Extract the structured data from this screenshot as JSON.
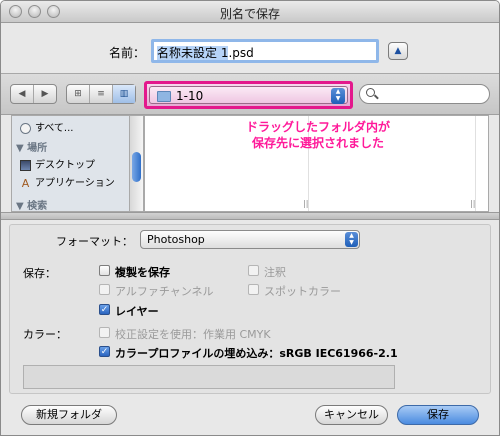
{
  "window": {
    "title": "別名で保存"
  },
  "name": {
    "label": "名前：",
    "selected": "名称未設定 1",
    "rest": ".psd"
  },
  "toolbar": {
    "nav_back": "◀",
    "nav_forward": "▶",
    "view_icon": "⊞",
    "view_list": "≡",
    "view_column": "▥",
    "current_folder": "1-10",
    "search_placeholder": ""
  },
  "sidebar": {
    "items": [
      {
        "label": "すべて...",
        "icon": "clock-icon"
      },
      {
        "label": "場所",
        "kind": "header"
      },
      {
        "label": "デスクトップ",
        "icon": "desktop-icon"
      },
      {
        "label": "アプリケーション",
        "icon": "applications-icon"
      },
      {
        "label": "検索",
        "kind": "header"
      }
    ]
  },
  "annotation": {
    "line1": "ドラッグしたフォルダ内が",
    "line2": "保存先に選択されました",
    "color": "#ff1a9a"
  },
  "options": {
    "format_label": "フォーマット：",
    "format_value": "Photoshop",
    "save_label": "保存：",
    "copy": {
      "label": "複製を保存",
      "checked": false,
      "enabled": true
    },
    "notes": {
      "label": "注釈",
      "checked": false,
      "enabled": false
    },
    "alpha": {
      "label": "アルファチャンネル",
      "checked": false,
      "enabled": false
    },
    "spot": {
      "label": "スポットカラー",
      "checked": false,
      "enabled": false
    },
    "layers": {
      "label": "レイヤー",
      "checked": true,
      "enabled": true
    },
    "color_label": "カラー：",
    "proof": {
      "label": "校正設定を使用：作業用 CMYK",
      "checked": false,
      "enabled": false
    },
    "icc": {
      "label": "カラープロファイルの埋め込み：sRGB IEC61966-2.1",
      "checked": true,
      "enabled": true
    }
  },
  "buttons": {
    "new_folder": "新規フォルダ",
    "cancel": "キャンセル",
    "save": "保存"
  },
  "colors": {
    "focus": "#8fb7e9",
    "highlight_border": "#e3188c",
    "accent": "#2a64c0"
  }
}
